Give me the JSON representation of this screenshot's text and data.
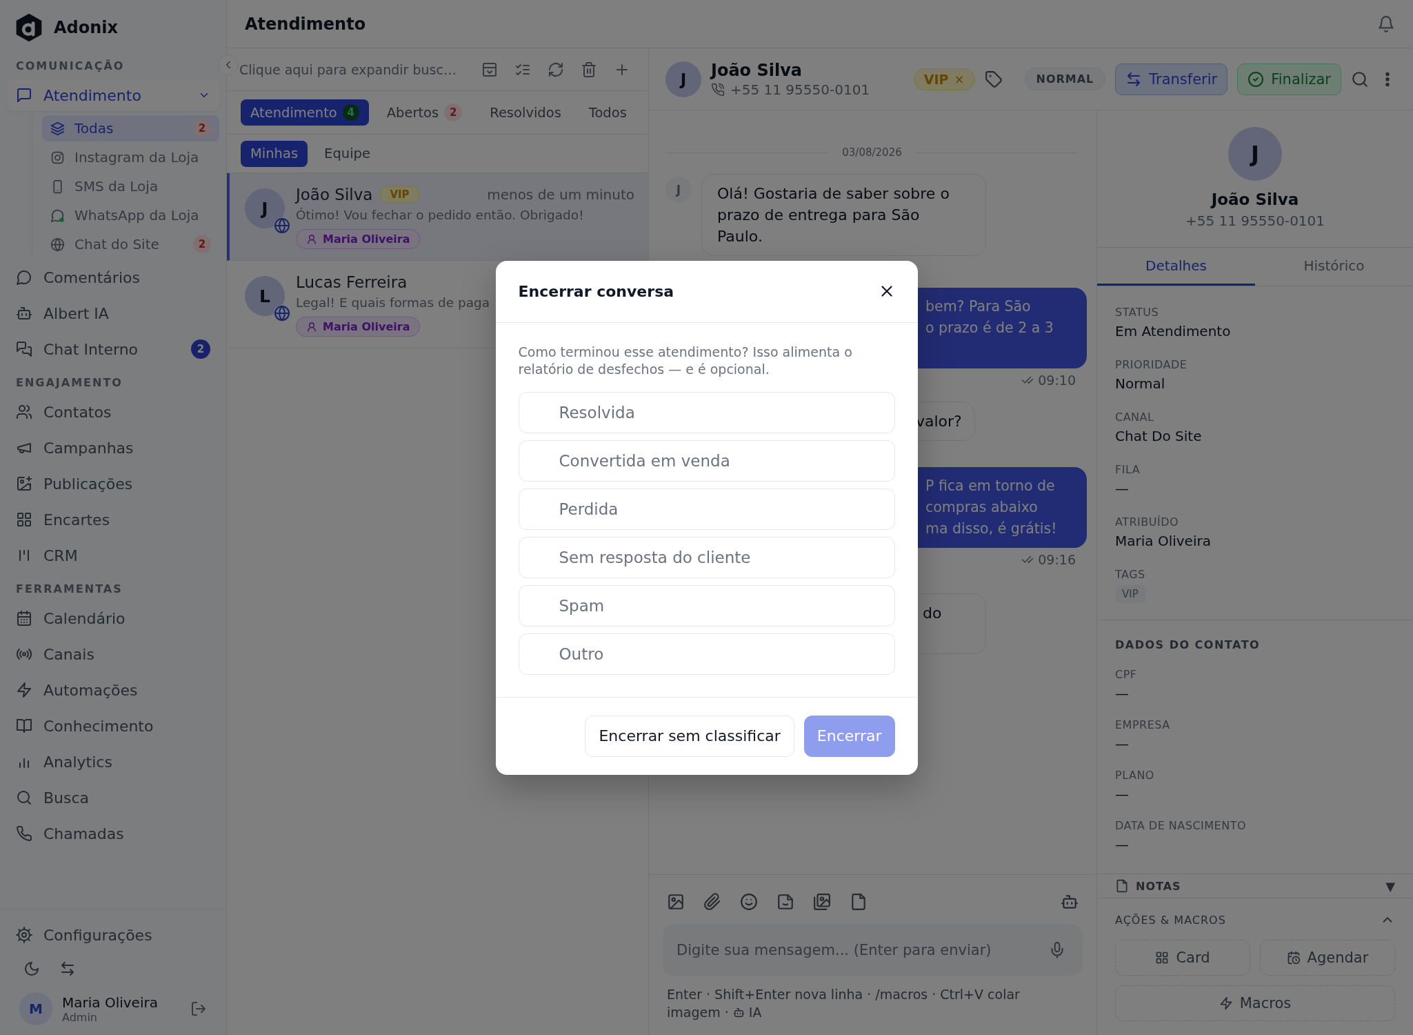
{
  "app": {
    "name": "Adonix"
  },
  "sidebar": {
    "sections": [
      {
        "title": "COMUNICAÇÃO",
        "items": [
          {
            "label": "Atendimento",
            "selected": true,
            "expanded": true,
            "children": [
              {
                "label": "Todas",
                "selected": true,
                "badge": {
                  "text": "2",
                  "kind": "alert"
                }
              },
              {
                "label": "Instagram da Loja",
                "selected": false
              },
              {
                "label": "SMS da Loja",
                "selected": false
              },
              {
                "label": "WhatsApp da Loja",
                "selected": false
              },
              {
                "label": "Chat do Site",
                "selected": false,
                "badge": {
                  "text": "2",
                  "kind": "alert"
                }
              }
            ]
          },
          {
            "label": "Comentários",
            "selected": false
          },
          {
            "label": "Albert IA",
            "selected": false
          },
          {
            "label": "Chat Interno",
            "selected": false,
            "badge": {
              "text": "2",
              "kind": "count"
            }
          }
        ]
      },
      {
        "title": "ENGAJAMENTO",
        "items": [
          {
            "label": "Contatos",
            "selected": false
          },
          {
            "label": "Campanhas",
            "selected": false
          },
          {
            "label": "Publicações",
            "selected": false
          },
          {
            "label": "Encartes",
            "selected": false
          },
          {
            "label": "CRM",
            "selected": false
          }
        ]
      },
      {
        "title": "FERRAMENTAS",
        "items": [
          {
            "label": "Calendário",
            "selected": false
          },
          {
            "label": "Canais",
            "selected": false
          },
          {
            "label": "Automações",
            "selected": false
          },
          {
            "label": "Conhecimento",
            "selected": false
          },
          {
            "label": "Analytics",
            "selected": false
          },
          {
            "label": "Busca",
            "selected": false
          },
          {
            "label": "Chamadas",
            "selected": false
          }
        ]
      }
    ],
    "footer_items": [
      {
        "label": "Configurações",
        "selected": false
      }
    ],
    "user": {
      "initial": "M",
      "name": "Maria Oliveira",
      "role": "Admin"
    }
  },
  "header": {
    "title": "Atendimento"
  },
  "conversations": {
    "search": {
      "placeholder": "Clique aqui para expandir busc…"
    },
    "tabs": [
      {
        "label": "Atendimento",
        "count": "4",
        "kind": "success",
        "selected": true
      },
      {
        "label": "Abertos",
        "count": "2",
        "kind": "alert",
        "selected": false
      },
      {
        "label": "Resolvidos",
        "selected": false
      },
      {
        "label": "Todos",
        "selected": false
      }
    ],
    "subtabs": [
      {
        "label": "Minhas",
        "selected": true
      },
      {
        "label": "Equipe",
        "selected": false
      }
    ],
    "items": [
      {
        "initial": "J",
        "name": "João Silva",
        "tag": "VIP",
        "time": "menos de um minuto",
        "preview": "Ótimo! Vou fechar o pedido então. Obrigado!",
        "assignee": "Maria Oliveira",
        "selected": true
      },
      {
        "initial": "L",
        "name": "Lucas Ferreira",
        "preview": "Legal! E quais formas de paga",
        "assignee": "Maria Oliveira",
        "selected": false
      }
    ]
  },
  "chat": {
    "contact": {
      "initial": "J",
      "name": "João Silva",
      "phone": "+55 11 95550-0101",
      "tag": "VIP",
      "tag_remove": "×",
      "priority": "NORMAL"
    },
    "actions": [
      {
        "label": "Transferir",
        "kind": "transfer"
      },
      {
        "label": "Finalizar",
        "kind": "finish"
      }
    ],
    "date": "03/08/2026",
    "messages": [
      {
        "kind": "incoming",
        "initial": "J",
        "lines": [
          "Olá! Gostaria de saber sobre o",
          "prazo de entrega para São",
          "Paulo."
        ]
      },
      {
        "kind": "outgoing",
        "partial": true,
        "lines": [
          "bem? Para São",
          "o prazo é de 2 a 3"
        ],
        "time": "09:10"
      },
      {
        "kind": "incoming",
        "partial": true,
        "lines": [
          "valor?"
        ]
      },
      {
        "kind": "outgoing",
        "partial": true,
        "lines": [
          "P fica em torno de",
          "compras abaixo",
          "ma disso, é grátis!"
        ],
        "time": "09:16"
      },
      {
        "kind": "incoming",
        "partial": true,
        "lines": [
          "do"
        ]
      }
    ],
    "composer": {
      "placeholder": "Digite sua mensagem... (Enter para enviar)",
      "hint": [
        "Enter · Shift+Enter nova linha · /macros · Ctrl+V colar",
        "imagem ·"
      ],
      "hint_ai": "IA"
    }
  },
  "details": {
    "initial": "J",
    "name": "João Silva",
    "phone": "+55 11 95550-0101",
    "tabs": [
      {
        "label": "Detalhes",
        "selected": true
      },
      {
        "label": "Histórico",
        "selected": false
      }
    ],
    "fields": [
      {
        "label": "STATUS",
        "value": "Em Atendimento"
      },
      {
        "label": "PRIORIDADE",
        "value": "Normal"
      },
      {
        "label": "CANAL",
        "value": "Chat Do Site"
      },
      {
        "label": "FILA",
        "value": "—"
      },
      {
        "label": "ATRIBUÍDO",
        "value": "Maria Oliveira"
      }
    ],
    "tags_label": "TAGS",
    "tags": [
      "VIP"
    ],
    "contact_title": "DADOS DO CONTATO",
    "contact_fields": [
      {
        "label": "CPF",
        "value": "—"
      },
      {
        "label": "EMPRESA",
        "value": "—"
      },
      {
        "label": "PLANO",
        "value": "—"
      },
      {
        "label": "DATA DE NASCIMENTO",
        "value": "—"
      }
    ],
    "notes": {
      "title": "NOTAS",
      "toggle": "▼"
    },
    "macros": {
      "title": "AÇÕES & MACROS",
      "expanded": true,
      "buttons": [
        {
          "label": "Card"
        },
        {
          "label": "Agendar"
        },
        {
          "label": "Macros"
        }
      ]
    }
  },
  "modal": {
    "title": "Encerrar conversa",
    "description": "Como terminou esse atendimento? Isso alimenta o relatório de desfechos — e é opcional.",
    "options": [
      {
        "label": "Resolvida",
        "selected": false
      },
      {
        "label": "Convertida em venda",
        "selected": false
      },
      {
        "label": "Perdida",
        "selected": false
      },
      {
        "label": "Sem resposta do cliente",
        "selected": false
      },
      {
        "label": "Spam",
        "selected": false
      },
      {
        "label": "Outro",
        "selected": false
      }
    ],
    "buttons": [
      {
        "label": "Encerrar sem classificar",
        "kind": "secondary",
        "disabled": false
      },
      {
        "label": "Encerrar",
        "kind": "primary",
        "disabled": true
      }
    ]
  }
}
